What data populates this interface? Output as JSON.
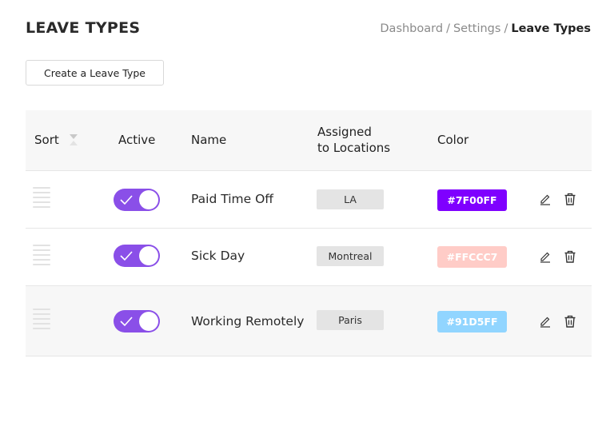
{
  "header": {
    "title": "LEAVE TYPES",
    "breadcrumb": {
      "items": [
        "Dashboard",
        "Settings"
      ],
      "current": "Leave Types",
      "separator": "/"
    }
  },
  "toolbar": {
    "create_label": "Create a Leave Type"
  },
  "table": {
    "headers": {
      "sort": "Sort",
      "active": "Active",
      "name": "Name",
      "assigned_line1": "Assigned",
      "assigned_line2": "to Locations",
      "color": "Color"
    },
    "rows": [
      {
        "active": true,
        "name": "Paid Time Off",
        "location": "LA",
        "color_label": "#7F00FF",
        "color": "#7F00FF"
      },
      {
        "active": true,
        "name": "Sick Day",
        "location": "Montreal",
        "color_label": "#FFCCC7",
        "color": "#FFCCC7"
      },
      {
        "active": true,
        "name": "Working Remotely",
        "location": "Paris",
        "color_label": "#91D5FF",
        "color": "#91D5FF"
      }
    ]
  },
  "icons": {
    "sort": "sort-icon",
    "drag": "drag-handle-icon",
    "check": "check-icon",
    "edit": "pencil-icon",
    "delete": "trash-icon"
  },
  "colors": {
    "toggle_on": "#8A4FE8",
    "header_bg": "#F7F7F7"
  }
}
